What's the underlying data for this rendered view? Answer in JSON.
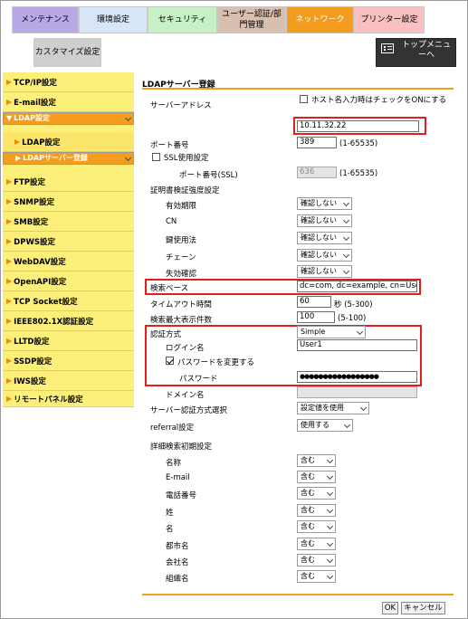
{
  "tabs": {
    "maintenance": "メンテナンス",
    "env": "環境設定",
    "security": "セキュリティ",
    "user_auth": "ユーザー認証/部門管理",
    "network": "ネットワーク",
    "printer": "プリンター設定",
    "customize": "カスタマイズ設定",
    "topmenu": "トップメニューへ"
  },
  "sidebar": [
    "TCP/IP設定",
    "E-mail設定",
    "LDAP設定",
    "LDAP設定",
    "LDAPサーバー登録",
    "FTP設定",
    "SNMP設定",
    "SMB設定",
    "DPWS設定",
    "WebDAV設定",
    "OpenAPI設定",
    "TCP Socket設定",
    "IEEE802.1X認証設定",
    "LLTD設定",
    "SSDP設定",
    "IWS設定",
    "リモートパネル設定"
  ],
  "form": {
    "title": "LDAPサーバー登録",
    "server_address_label": "サーバーアドレス",
    "hostname_check_label": "ホスト名入力時はチェックをONにする",
    "server_address": "10.11.32.22",
    "port_label": "ポート番号",
    "port": "389",
    "port_range": "(1-65535)",
    "ssl_label": "SSL使用設定",
    "ssl_port_label": "ポート番号(SSL)",
    "ssl_port": "636",
    "ssl_port_range": "(1-65535)",
    "cert_label": "証明書検証強度設定",
    "cert_items": [
      {
        "label": "有効期限",
        "value": "確認しない"
      },
      {
        "label": "CN",
        "value": "確認しない"
      },
      {
        "label": "鍵使用法",
        "value": "確認しない"
      },
      {
        "label": "チェーン",
        "value": "確認しない"
      },
      {
        "label": "失効確認",
        "value": "確認しない"
      }
    ],
    "search_base_label": "検索ベース",
    "search_base": "dc=com, dc=example, cn=Users",
    "timeout_label": "タイムアウト時間",
    "timeout": "60",
    "timeout_range": "秒 (5-300)",
    "max_results_label": "検索最大表示件数",
    "max_results": "100",
    "max_results_range": "(5-100)",
    "auth_label": "認証方式",
    "auth": "Simple",
    "login_label": "ログイン名",
    "login": "User1",
    "change_pw_label": "パスワードを変更する",
    "password_label": "パスワード",
    "password": "●●●●●●●●●●●●●●●●●",
    "domain_label": "ドメイン名",
    "server_auth_label": "サーバー認証方式選択",
    "server_auth": "設定値を使用",
    "referral_label": "referral設定",
    "referral": "使用する",
    "search_init_label": "詳細検索初期設定",
    "search_items": [
      {
        "label": "名称",
        "value": "含む"
      },
      {
        "label": "E-mail",
        "value": "含む"
      },
      {
        "label": "電話番号",
        "value": "含む"
      },
      {
        "label": "姓",
        "value": "含む"
      },
      {
        "label": "名",
        "value": "含む"
      },
      {
        "label": "都市名",
        "value": "含む"
      },
      {
        "label": "会社名",
        "value": "含む"
      },
      {
        "label": "組織名",
        "value": "含む"
      }
    ]
  },
  "buttons": {
    "ok": "OK",
    "cancel": "キャンセル"
  }
}
